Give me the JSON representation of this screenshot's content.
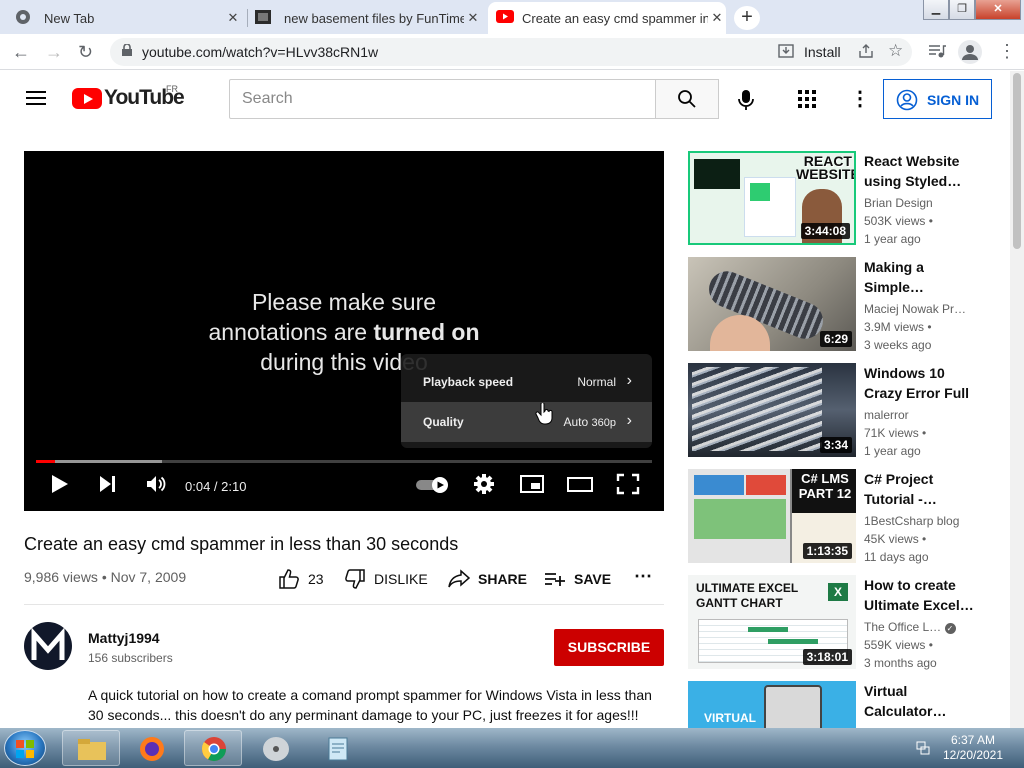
{
  "browser": {
    "tabs": [
      {
        "title": "New Tab",
        "active": false
      },
      {
        "title": "new basement files by FunTime",
        "active": false
      },
      {
        "title": "Create an easy cmd spammer in",
        "active": true
      }
    ],
    "url": "youtube.com/watch?v=HLvv38cRN1w",
    "install_label": "Install"
  },
  "youtube": {
    "logo_text": "YouTube",
    "region": "FR",
    "search_placeholder": "Search",
    "sign_in": "SIGN IN"
  },
  "player": {
    "annotation": {
      "line1": "Please make sure",
      "line2_prefix": "annotations are ",
      "line2_bold": "turned on",
      "line3": "during this video"
    },
    "menu": [
      {
        "label": "Playback speed",
        "value": "Normal",
        "value_suffix": ""
      },
      {
        "label": "Quality",
        "value": "Auto",
        "value_suffix": "360p"
      }
    ],
    "time": "0:04 / 2:10",
    "played_fraction": 0.031,
    "buffered_fraction": 0.205
  },
  "video": {
    "title": "Create an easy cmd spammer in less than 30 seconds",
    "views_date": "9,986 views • Nov 7, 2009",
    "likes": "23",
    "dislike": "DISLIKE",
    "share": "SHARE",
    "save": "SAVE",
    "channel": "Mattyj1994",
    "subscribers": "156 subscribers",
    "subscribe": "SUBSCRIBE",
    "description": "A quick tutorial on how to create a comand prompt spammer for Windows Vista in less than 30 seconds... this doesn't do any perminant damage to your PC, just freezes it for ages!!!"
  },
  "recommendations": [
    {
      "title": "React Website using Styled…",
      "channel": "Brian Design",
      "views": "503K views •",
      "age": "1 year ago",
      "duration": "3:44:08",
      "thumb_text": "REACT WEBSITE"
    },
    {
      "title": "Making a Simple…",
      "channel": "Maciej Nowak Pr…",
      "views": "3.9M views •",
      "age": "3 weeks ago",
      "duration": "6:29",
      "thumb_text": ""
    },
    {
      "title": "Windows 10 Crazy Error Full",
      "channel": "malerror",
      "views": "71K views •",
      "age": "1 year ago",
      "duration": "3:34",
      "thumb_text": ""
    },
    {
      "title": "C# Project Tutorial -…",
      "channel": "1BestCsharp blog",
      "views": "45K views •",
      "age": "11 days ago",
      "duration": "1:13:35",
      "thumb_text": "C# LMS PART 12"
    },
    {
      "title": "How to create Ultimate Excel…",
      "channel": "The Office L…",
      "views": "559K views •",
      "age": "3 months ago",
      "duration": "3:18:01",
      "thumb_text": "ULTIMATE EXCEL GANTT CHART"
    },
    {
      "title": "Virtual Calculator…",
      "channel": "",
      "views": "",
      "age": "",
      "duration": "",
      "thumb_text": "VIRTUAL"
    }
  ],
  "taskbar": {
    "time": "6:37 AM",
    "date": "12/20/2021"
  },
  "colors": {
    "youtube_red": "#ff0000",
    "subscribe_red": "#cc0000",
    "link_blue": "#065fd4"
  }
}
